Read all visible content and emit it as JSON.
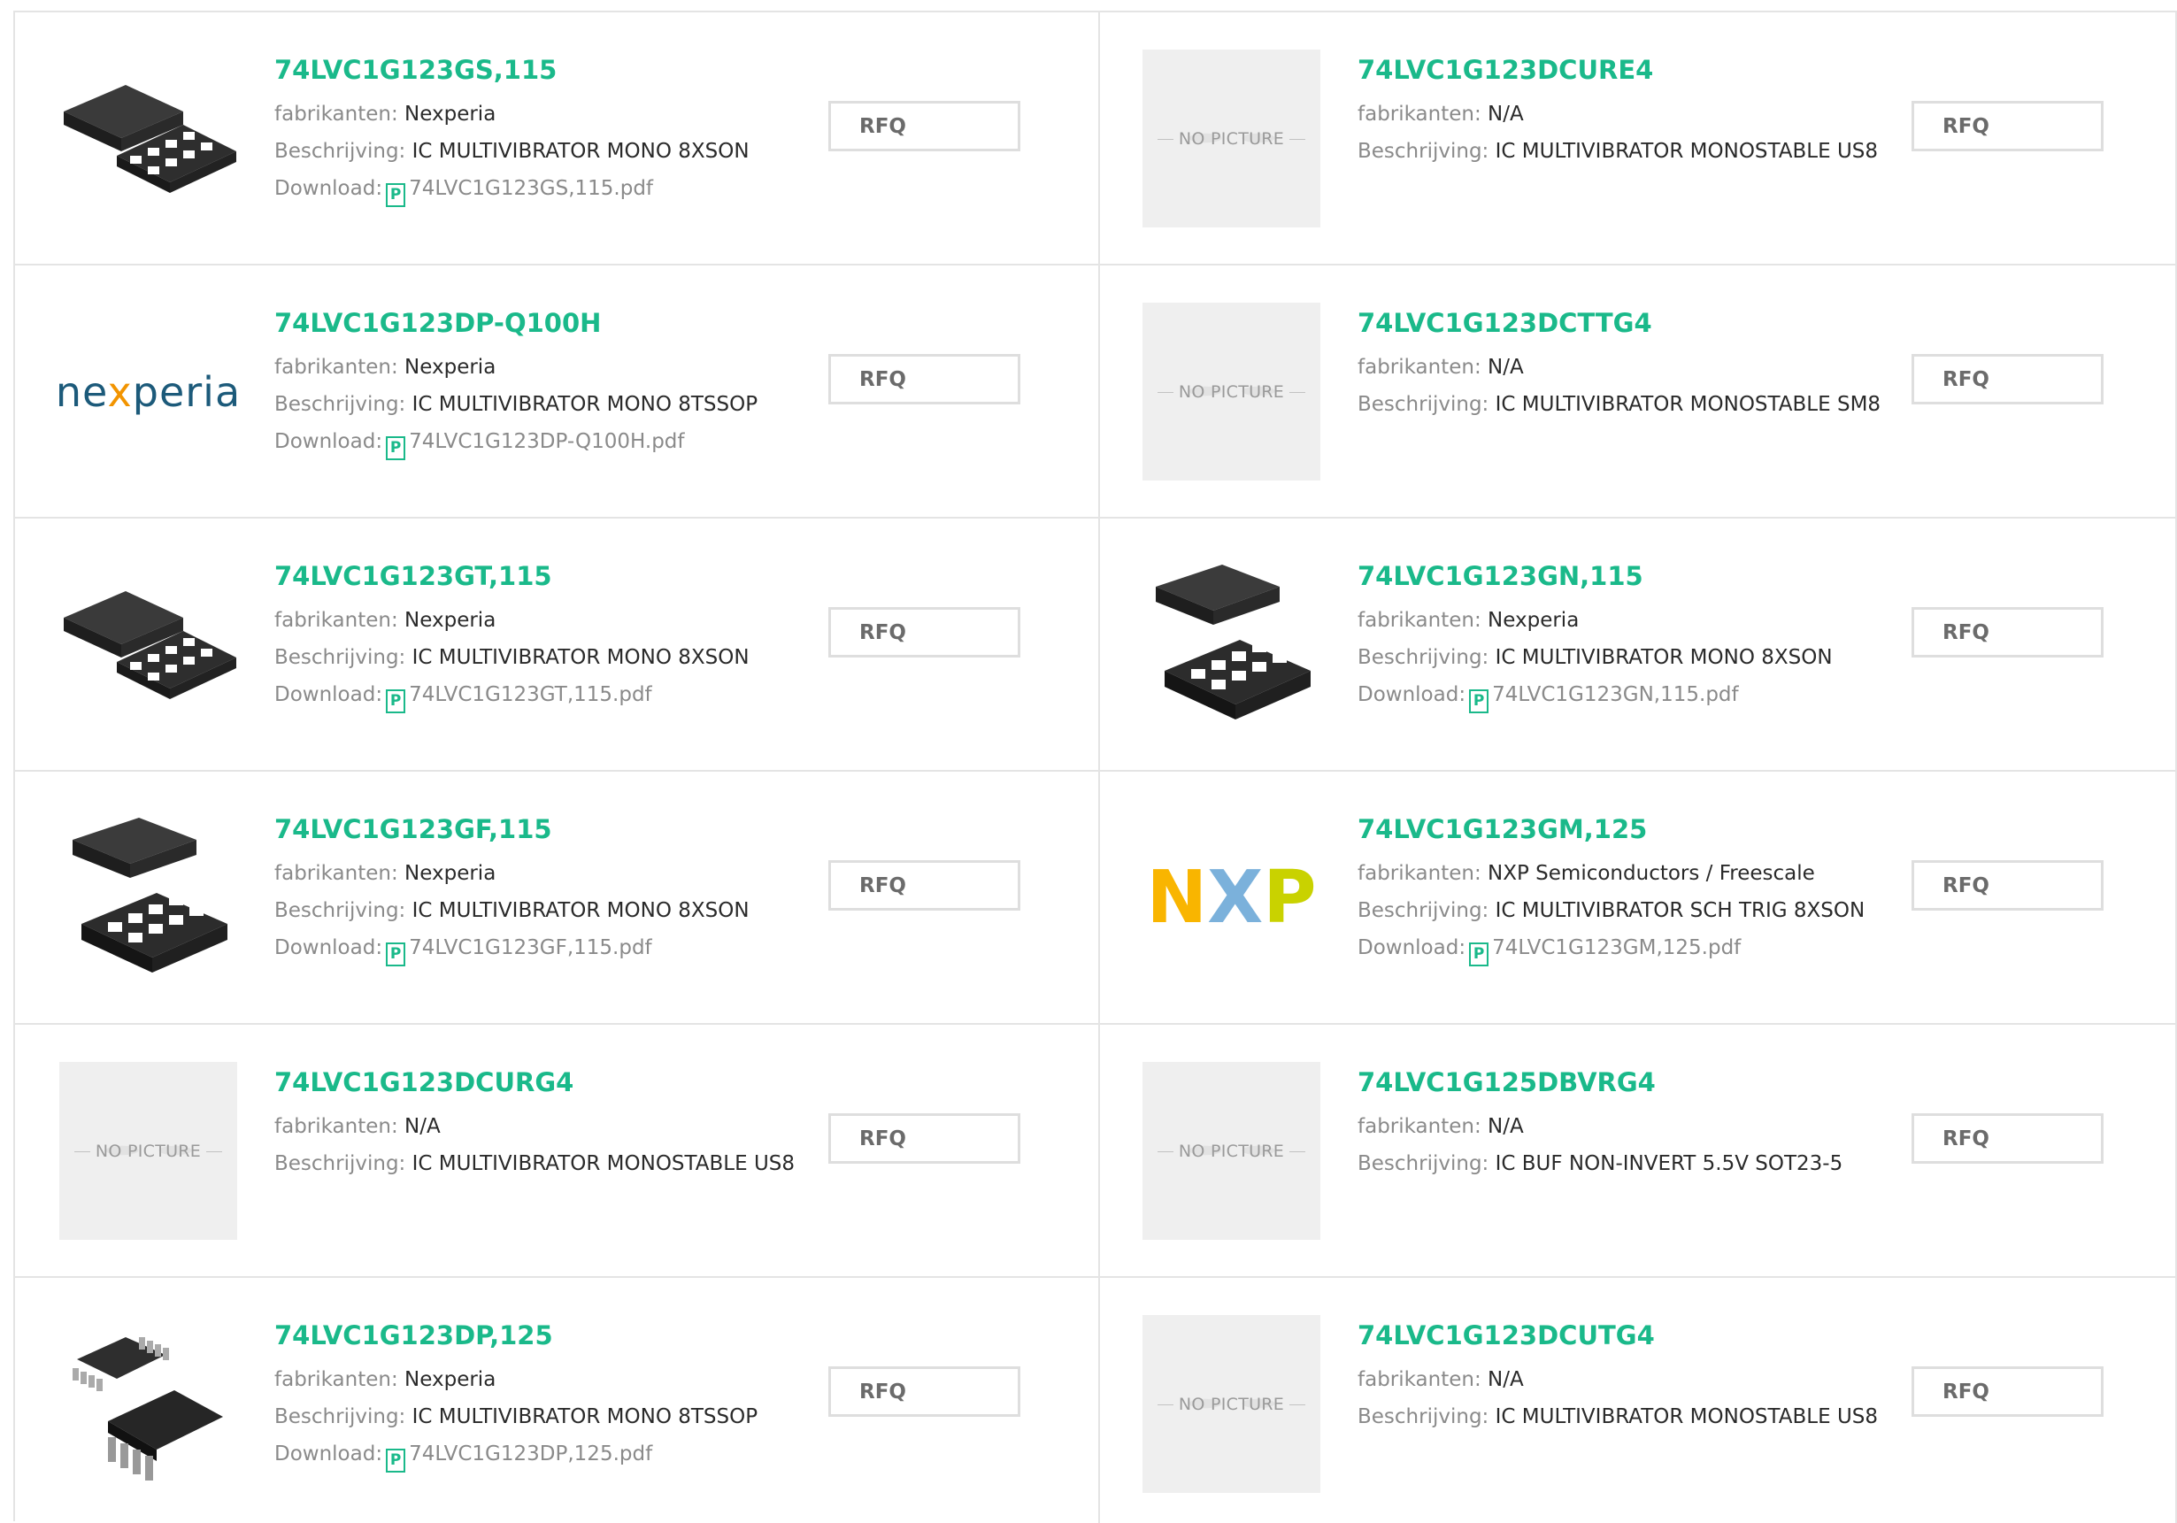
{
  "labels": {
    "manufacturer": "fabrikanten:",
    "description": "Beschrijving:",
    "download": "Download:",
    "rfq": "RFQ",
    "no_picture": "NO PICTURE"
  },
  "brand_color": "#1ab98a",
  "products": [
    {
      "part": "74LVC1G123GS,115",
      "manufacturer": "Nexperia",
      "description": "IC MULTIVIBRATOR MONO 8XSON",
      "download": "74LVC1G123GS,115.pdf",
      "image": "xson-chip-icon"
    },
    {
      "part": "74LVC1G123DCURE4",
      "manufacturer": "N/A",
      "description": "IC MULTIVIBRATOR MONOSTABLE US8",
      "download": null,
      "image": "no-picture"
    },
    {
      "part": "74LVC1G123DP-Q100H",
      "manufacturer": "Nexperia",
      "description": "IC MULTIVIBRATOR MONO 8TSSOP",
      "download": "74LVC1G123DP-Q100H.pdf",
      "image": "nexperia-logo",
      "logo_text": "nexperia"
    },
    {
      "part": "74LVC1G123DCTTG4",
      "manufacturer": "N/A",
      "description": "IC MULTIVIBRATOR MONOSTABLE SM8",
      "download": null,
      "image": "no-picture"
    },
    {
      "part": "74LVC1G123GT,115",
      "manufacturer": "Nexperia",
      "description": "IC MULTIVIBRATOR MONO 8XSON",
      "download": "74LVC1G123GT,115.pdf",
      "image": "xson-chip-icon"
    },
    {
      "part": "74LVC1G123GN,115",
      "manufacturer": "Nexperia",
      "description": "IC MULTIVIBRATOR MONO 8XSON",
      "download": "74LVC1G123GN,115.pdf",
      "image": "xson-chip-tall-icon"
    },
    {
      "part": "74LVC1G123GF,115",
      "manufacturer": "Nexperia",
      "description": "IC MULTIVIBRATOR MONO 8XSON",
      "download": "74LVC1G123GF,115.pdf",
      "image": "xson-chip-tall-icon"
    },
    {
      "part": "74LVC1G123GM,125",
      "manufacturer": "NXP Semiconductors / Freescale",
      "description": "IC MULTIVIBRATOR SCH TRIG 8XSON",
      "download": "74LVC1G123GM,125.pdf",
      "image": "nxp-logo",
      "logo_text": "NXP"
    },
    {
      "part": "74LVC1G123DCURG4",
      "manufacturer": "N/A",
      "description": "IC MULTIVIBRATOR MONOSTABLE US8",
      "download": null,
      "image": "no-picture"
    },
    {
      "part": "74LVC1G125DBVRG4",
      "manufacturer": "N/A",
      "description": "IC BUF NON-INVERT 5.5V SOT23-5",
      "download": null,
      "image": "no-picture"
    },
    {
      "part": "74LVC1G123DP,125",
      "manufacturer": "Nexperia",
      "description": "IC MULTIVIBRATOR MONO 8TSSOP",
      "download": "74LVC1G123DP,125.pdf",
      "image": "tssop-chip-icon"
    },
    {
      "part": "74LVC1G123DCUTG4",
      "manufacturer": "N/A",
      "description": "IC MULTIVIBRATOR MONOSTABLE US8",
      "download": null,
      "image": "no-picture"
    }
  ]
}
